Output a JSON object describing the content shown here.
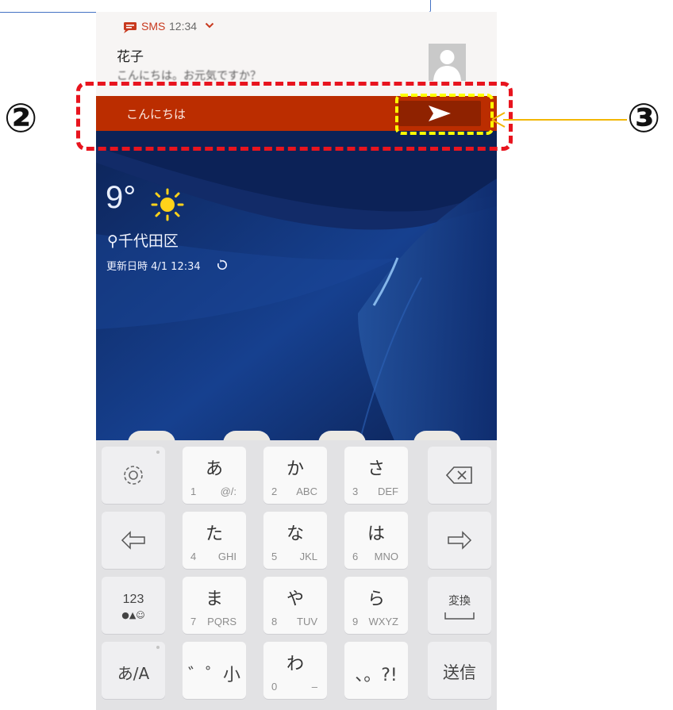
{
  "notification": {
    "app": "SMS",
    "time": "12:34",
    "sender": "花子",
    "preview": "こんにちは。お元気ですか？"
  },
  "reply": {
    "text": "こんにちは",
    "send_icon": "send-arrow-icon"
  },
  "weather": {
    "temperature": "9°",
    "location": "千代田区",
    "updated": "更新日時 4/1  12:34",
    "condition_icon": "sun-icon"
  },
  "keyboard": {
    "rows": [
      [
        {
          "type": "fn",
          "icon": "gear-icon"
        },
        {
          "main": "あ",
          "num": "1",
          "sub": "@/:"
        },
        {
          "main": "か",
          "num": "2",
          "sub": "ABC"
        },
        {
          "main": "さ",
          "num": "3",
          "sub": "DEF"
        },
        {
          "type": "fn",
          "icon": "backspace-icon"
        }
      ],
      [
        {
          "type": "fn",
          "icon": "left-arrow-icon"
        },
        {
          "main": "た",
          "num": "4",
          "sub": "GHI"
        },
        {
          "main": "な",
          "num": "5",
          "sub": "JKL"
        },
        {
          "main": "は",
          "num": "6",
          "sub": "MNO"
        },
        {
          "type": "fn",
          "icon": "right-arrow-icon"
        }
      ],
      [
        {
          "type": "fn",
          "label": "123",
          "sublabel": "●▲☺"
        },
        {
          "main": "ま",
          "num": "7",
          "sub": "PQRS"
        },
        {
          "main": "や",
          "num": "8",
          "sub": "TUV"
        },
        {
          "main": "ら",
          "num": "9",
          "sub": "WXYZ"
        },
        {
          "type": "fn",
          "label": "変換"
        }
      ],
      [
        {
          "type": "fn",
          "label": "あ/A"
        },
        {
          "main": "゛゜小"
        },
        {
          "main": "わ",
          "num": "0",
          "sub": "–"
        },
        {
          "main": "、。?!"
        },
        {
          "type": "fn",
          "label": "送信"
        }
      ]
    ]
  },
  "annotations": {
    "label_2": "②",
    "label_3": "③"
  },
  "colors": {
    "reply_bar": "#bb2d00",
    "send_button": "#8f2200",
    "annotation_red": "#e8141e",
    "annotation_yellow": "#ffff00",
    "arrow": "#f2b705"
  }
}
